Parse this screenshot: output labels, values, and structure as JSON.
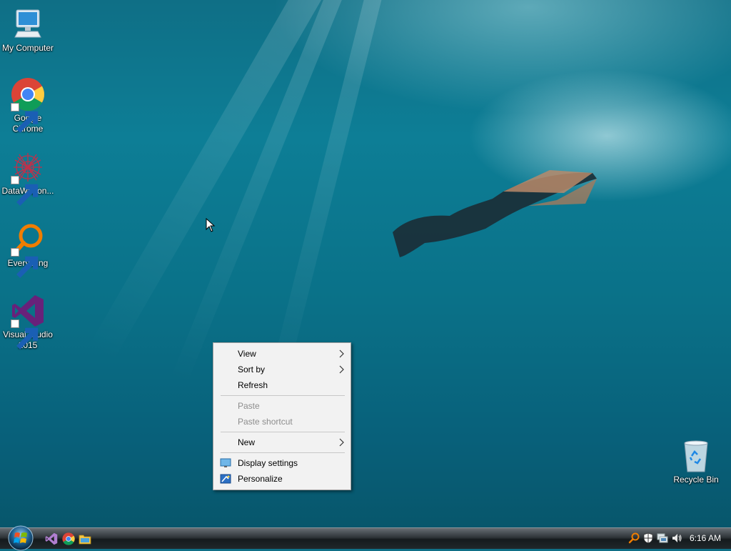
{
  "desktop": {
    "icons": [
      {
        "label": "My Computer",
        "icon": "monitor-icon",
        "shortcut": false
      },
      {
        "label": "Google Chrome",
        "icon": "chrome-icon",
        "shortcut": true
      },
      {
        "label": "DataWagon...",
        "icon": "datawagon-icon",
        "shortcut": true
      },
      {
        "label": "Everything",
        "icon": "magnifier-icon",
        "shortcut": true
      },
      {
        "label": "Visual Studio 2015",
        "icon": "visual-studio-icon",
        "shortcut": true
      },
      {
        "label": "Recycle Bin",
        "icon": "recycle-bin-icon",
        "shortcut": false
      }
    ]
  },
  "context_menu": {
    "items": [
      {
        "label": "View",
        "submenu": true,
        "enabled": true
      },
      {
        "label": "Sort by",
        "submenu": true,
        "enabled": true
      },
      {
        "label": "Refresh",
        "submenu": false,
        "enabled": true
      },
      {
        "label": "Paste",
        "submenu": false,
        "enabled": false
      },
      {
        "label": "Paste shortcut",
        "submenu": false,
        "enabled": false
      },
      {
        "label": "New",
        "submenu": true,
        "enabled": true
      },
      {
        "label": "Display settings",
        "submenu": false,
        "enabled": true,
        "icon": "display-settings-icon"
      },
      {
        "label": "Personalize",
        "submenu": false,
        "enabled": true,
        "icon": "personalize-icon"
      }
    ]
  },
  "taskbar": {
    "start_icon": "windows-orb-icon",
    "quick_launch": [
      "visual-studio-icon",
      "chrome-icon",
      "folder-icon"
    ],
    "tray_icons": [
      "search-icon",
      "security-flag-icon",
      "network-icon",
      "volume-icon"
    ],
    "clock": "6:16 AM"
  },
  "colors": {
    "menu_bg": "#f2f2f2",
    "disabled_text": "#8d8d8d",
    "taskbar": "#20272b"
  }
}
